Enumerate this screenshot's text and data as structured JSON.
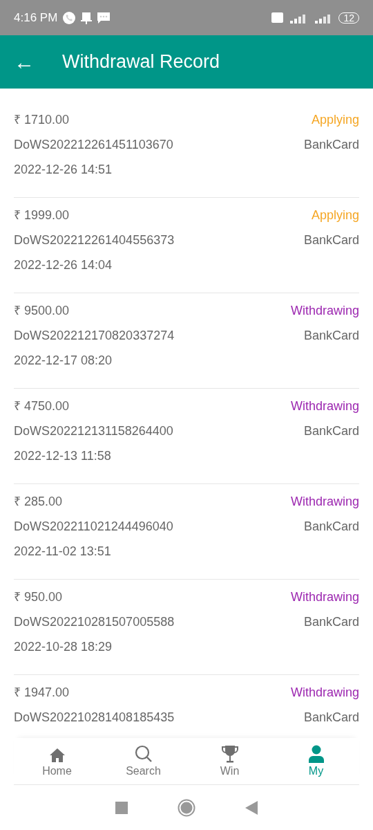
{
  "status_bar": {
    "time": "4:16 PM",
    "battery": "12"
  },
  "header": {
    "back": "←",
    "title": "Withdrawal Record"
  },
  "records": [
    {
      "amount": "₹ 1710.00",
      "status": "Applying",
      "color": "#f5a623",
      "order": "DoWS202212261451103670",
      "method": "BankCard",
      "date": "2022-12-26 14:51"
    },
    {
      "amount": "₹ 1999.00",
      "status": "Applying",
      "color": "#f5a623",
      "order": "DoWS202212261404556373",
      "method": "BankCard",
      "date": "2022-12-26 14:04"
    },
    {
      "amount": "₹ 9500.00",
      "status": "Withdrawing",
      "color": "#9c27b0",
      "order": "DoWS202212170820337274",
      "method": "BankCard",
      "date": "2022-12-17 08:20"
    },
    {
      "amount": "₹ 4750.00",
      "status": "Withdrawing",
      "color": "#9c27b0",
      "order": "DoWS202212131158264400",
      "method": "BankCard",
      "date": "2022-12-13 11:58"
    },
    {
      "amount": "₹ 285.00",
      "status": "Withdrawing",
      "color": "#9c27b0",
      "order": "DoWS202211021244496040",
      "method": "BankCard",
      "date": "2022-11-02 13:51"
    },
    {
      "amount": "₹ 950.00",
      "status": "Withdrawing",
      "color": "#9c27b0",
      "order": "DoWS202210281507005588",
      "method": "BankCard",
      "date": "2022-10-28 18:29"
    },
    {
      "amount": "₹ 1947.00",
      "status": "Withdrawing",
      "color": "#9c27b0",
      "order": "DoWS202210281408185435",
      "method": "BankCard"
    }
  ],
  "bottom_nav": [
    {
      "kind": "home",
      "label": "Home",
      "selected": false
    },
    {
      "kind": "search",
      "label": "Search",
      "selected": false
    },
    {
      "kind": "trophy",
      "label": "Win",
      "selected": false
    },
    {
      "kind": "person",
      "label": "My",
      "selected": true
    }
  ]
}
